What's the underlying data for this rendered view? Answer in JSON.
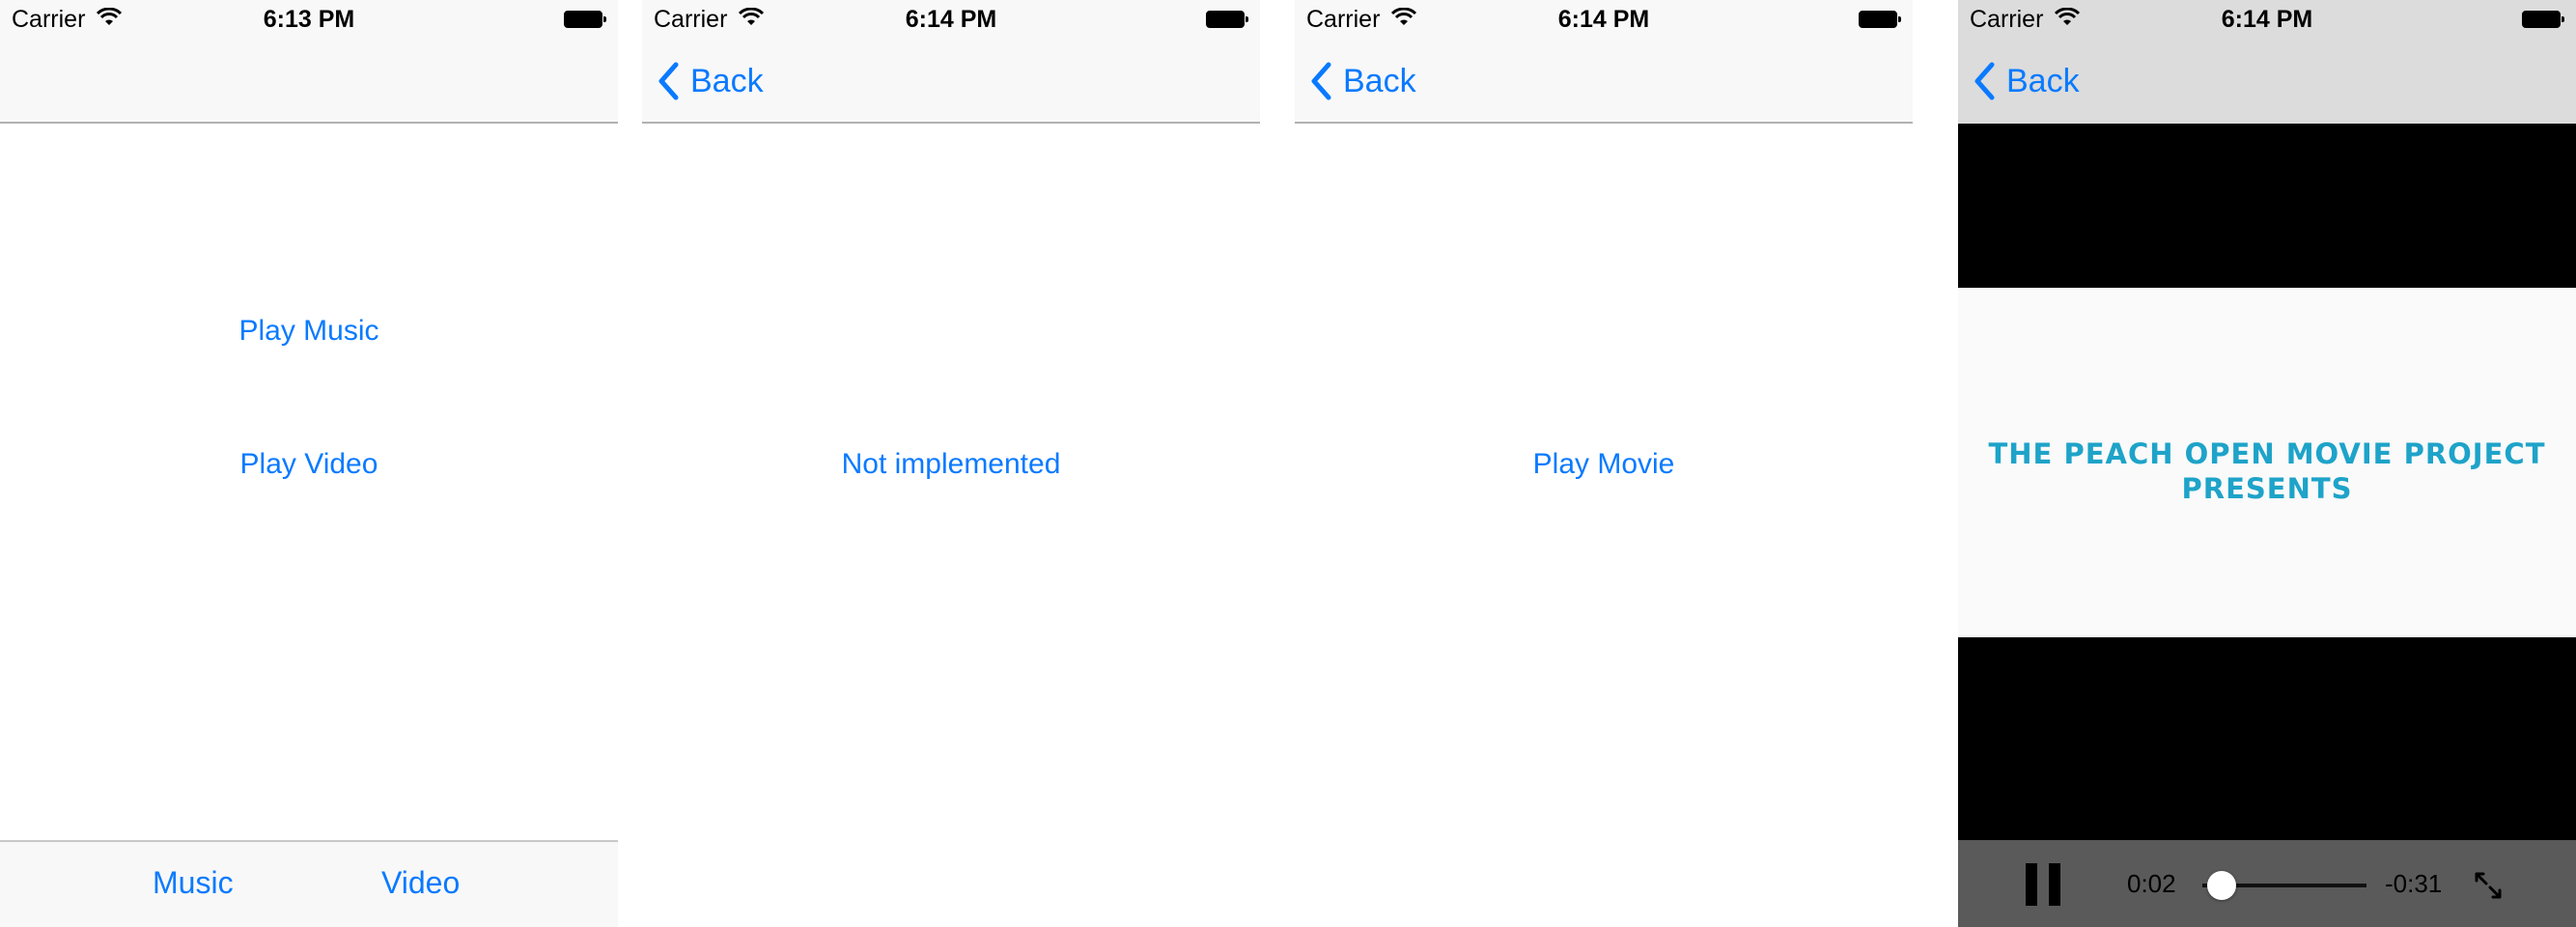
{
  "screens": [
    {
      "status": {
        "carrier": "Carrier",
        "time": "6:13 PM"
      },
      "buttons": [
        "Play Music",
        "Play Video"
      ],
      "tabs": [
        "Music",
        "Video"
      ]
    },
    {
      "status": {
        "carrier": "Carrier",
        "time": "6:14 PM"
      },
      "back_label": "Back",
      "message": "Not implemented"
    },
    {
      "status": {
        "carrier": "Carrier",
        "time": "6:14 PM"
      },
      "back_label": "Back",
      "button": "Play Movie"
    },
    {
      "status": {
        "carrier": "Carrier",
        "time": "6:14 PM"
      },
      "back_label": "Back",
      "video_title_line1": "THE PEACH OPEN MOVIE PROJECT",
      "video_title_line2": "PRESENTS",
      "elapsed": "0:02",
      "remaining": "-0:31",
      "progress_fraction": 0.06
    }
  ],
  "colors": {
    "accent": "#0a7aff",
    "video_title": "#1ea3c9"
  },
  "icons": [
    "wifi-icon",
    "battery-icon",
    "chevron-left-icon",
    "pause-icon",
    "fullscreen-icon"
  ]
}
